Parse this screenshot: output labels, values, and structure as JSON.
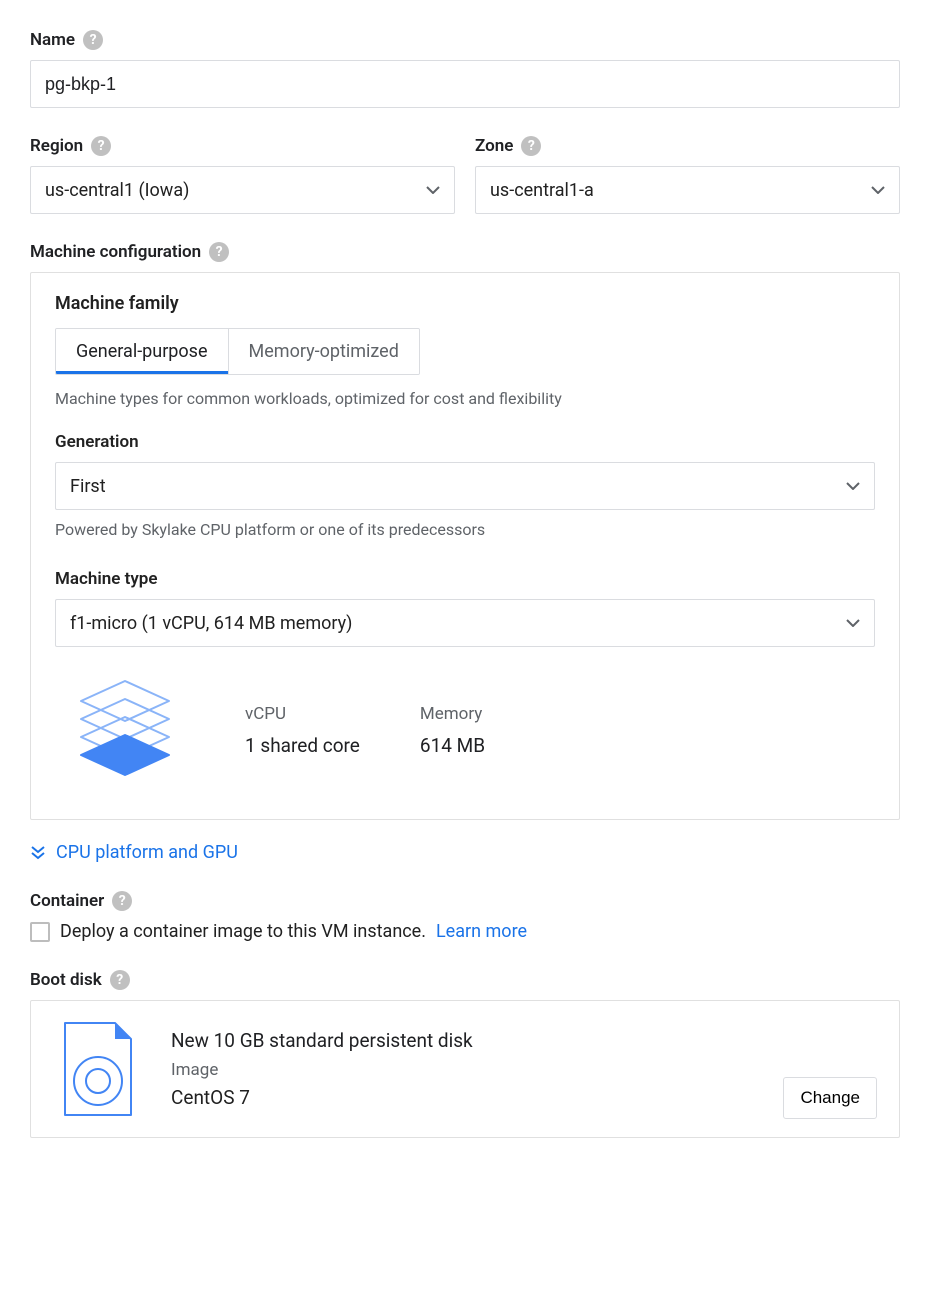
{
  "name": {
    "label": "Name",
    "value": "pg-bkp-1"
  },
  "region": {
    "label": "Region",
    "value": "us-central1 (Iowa)"
  },
  "zone": {
    "label": "Zone",
    "value": "us-central1-a"
  },
  "machine_config": {
    "label": "Machine configuration",
    "family_label": "Machine family",
    "tabs": {
      "general": "General-purpose",
      "memory": "Memory-optimized"
    },
    "family_hint": "Machine types for common workloads, optimized for cost and flexibility",
    "generation": {
      "label": "Generation",
      "value": "First",
      "hint": "Powered by Skylake CPU platform or one of its predecessors"
    },
    "machine_type": {
      "label": "Machine type",
      "value": "f1-micro (1 vCPU, 614 MB memory)"
    },
    "specs": {
      "vcpu_label": "vCPU",
      "vcpu_value": "1 shared core",
      "mem_label": "Memory",
      "mem_value": "614 MB"
    }
  },
  "expand": {
    "label": "CPU platform and GPU"
  },
  "container": {
    "label": "Container",
    "text": "Deploy a container image to this VM instance.",
    "learn_more": "Learn more"
  },
  "boot_disk": {
    "label": "Boot disk",
    "title": "New 10 GB standard persistent disk",
    "image_label": "Image",
    "image_value": "CentOS 7",
    "change": "Change"
  }
}
